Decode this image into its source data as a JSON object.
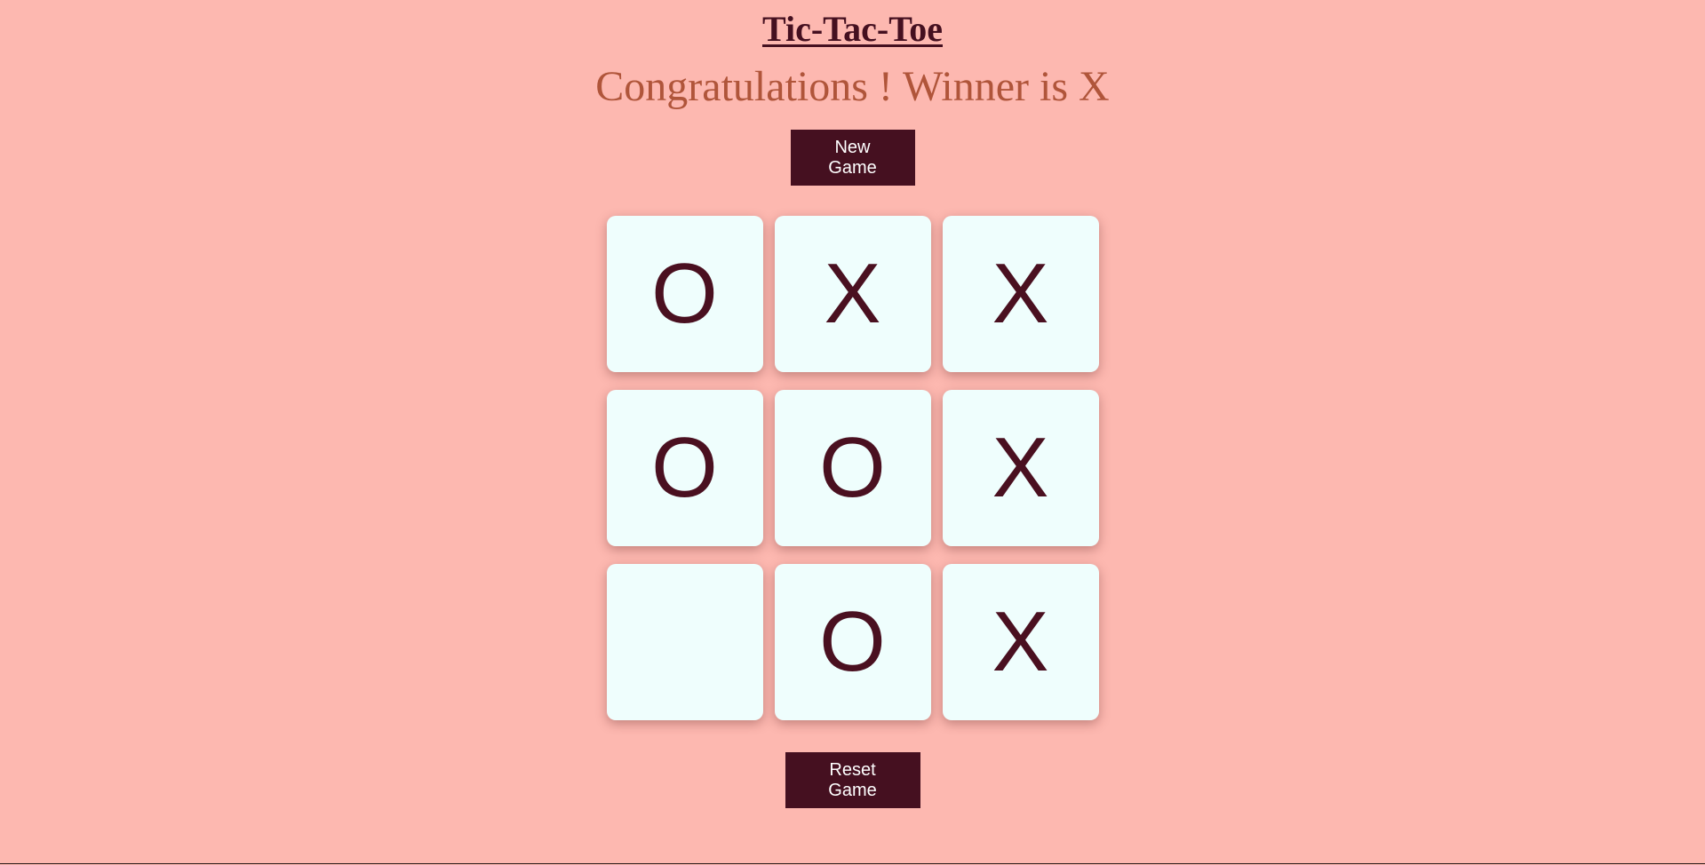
{
  "header": {
    "title": "Tic-Tac-Toe",
    "status_message": "Congratulations ! Winner is X"
  },
  "controls": {
    "new_game_label": "New Game",
    "reset_game_label": "Reset Game"
  },
  "board": {
    "cells": [
      "O",
      "X",
      "X",
      "O",
      "O",
      "X",
      "",
      "O",
      "X"
    ]
  },
  "colors": {
    "background": "#fdb8b0",
    "button": "#451020",
    "cell": "#effefd",
    "mark": "#4a1020",
    "status": "#b0553a"
  }
}
